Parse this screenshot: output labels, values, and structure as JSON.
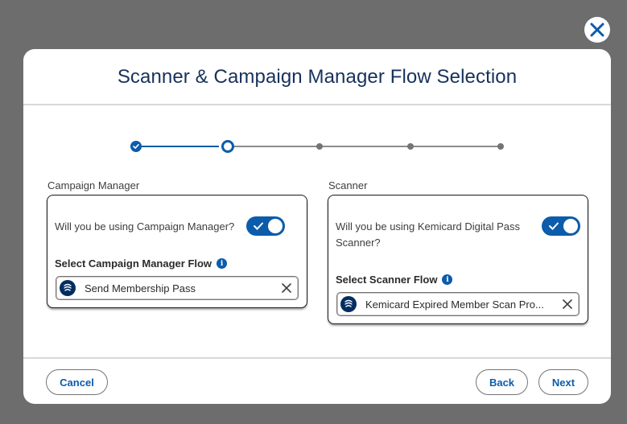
{
  "modal": {
    "title": "Scanner & Campaign Manager Flow Selection"
  },
  "stepper": {
    "total_steps": 5,
    "current_step": 2,
    "completed_steps": 1
  },
  "campaign_manager": {
    "section_label": "Campaign Manager",
    "question": "Will you be using Campaign Manager?",
    "toggle_on": true,
    "field_label": "Select Campaign Manager Flow",
    "selected_flow": "Send Membership Pass"
  },
  "scanner": {
    "section_label": "Scanner",
    "question": "Will you be using Kemicard Digital Pass Scanner?",
    "toggle_on": true,
    "field_label": "Select Scanner Flow",
    "selected_flow": "Kemicard Expired Member Scan Pro..."
  },
  "footer": {
    "cancel_label": "Cancel",
    "back_label": "Back",
    "next_label": "Next"
  },
  "icons": {
    "close": "close-icon",
    "info": "info-icon",
    "flow": "flow-icon",
    "clear": "clear-icon",
    "check": "check-icon"
  },
  "colors": {
    "brand": "#0b5cab",
    "title": "#16325c",
    "backdrop": "#6d6d6d"
  }
}
